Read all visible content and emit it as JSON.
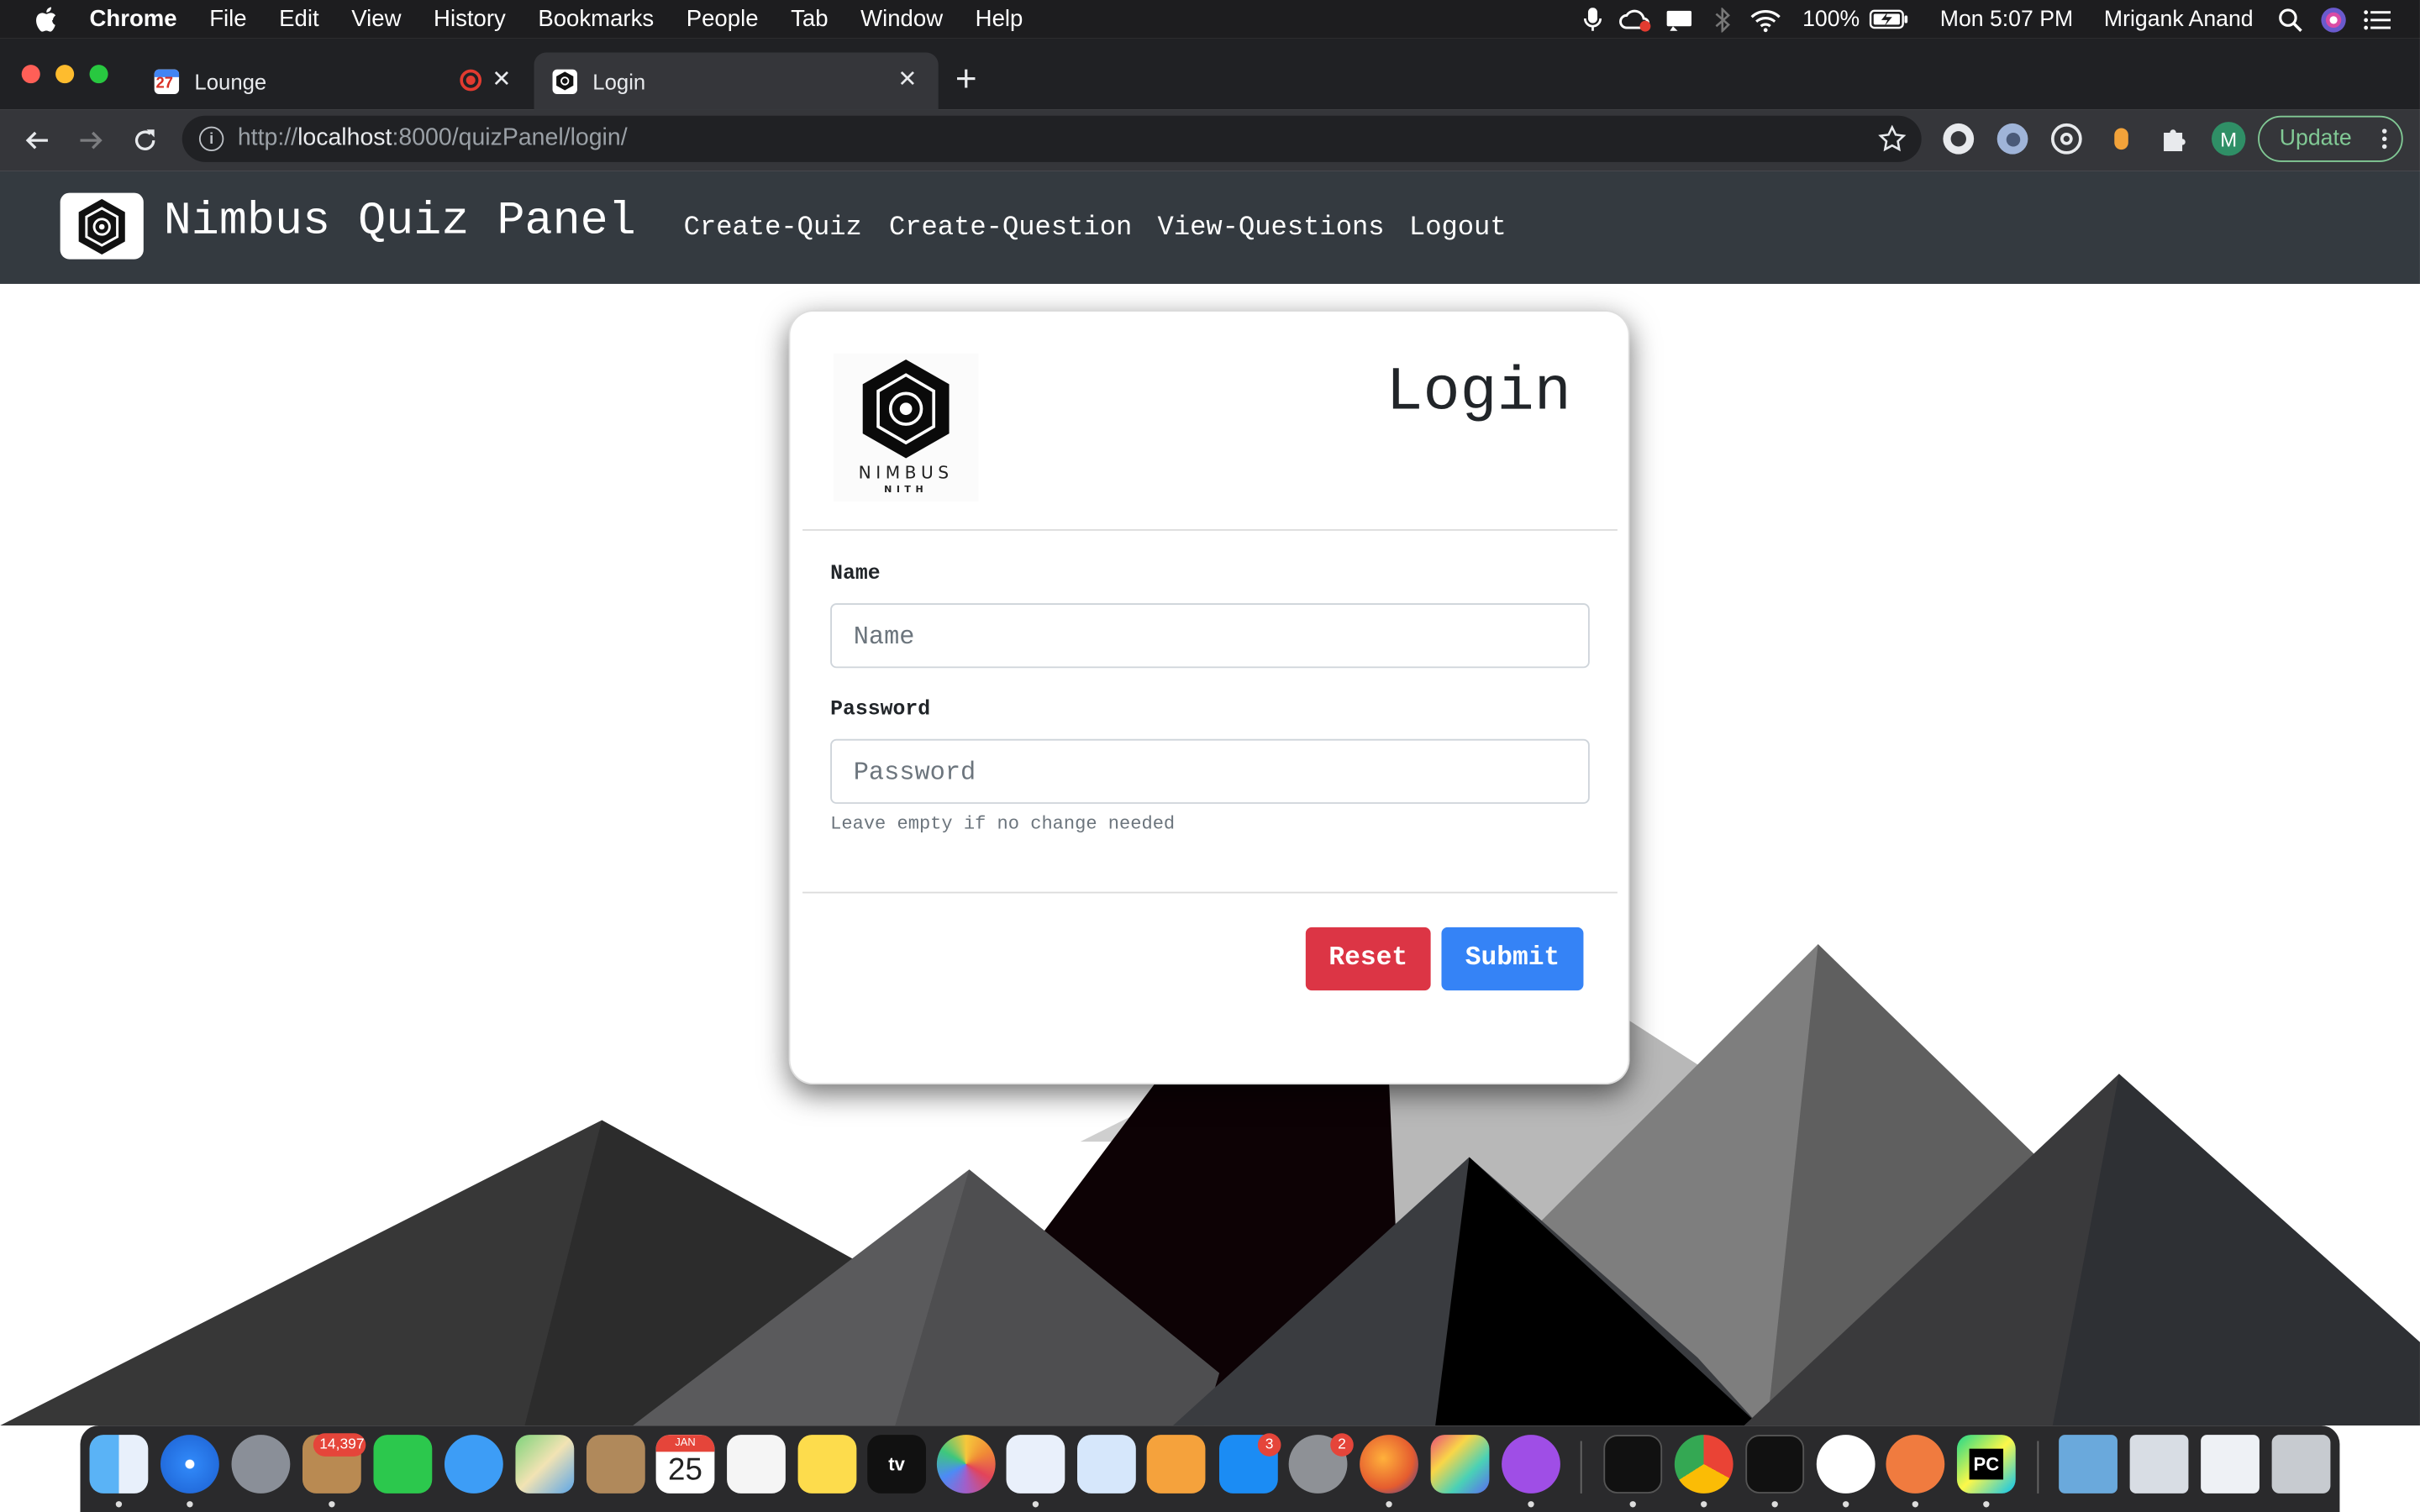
{
  "menubar": {
    "app": "Chrome",
    "items": [
      "File",
      "Edit",
      "View",
      "History",
      "Bookmarks",
      "People",
      "Tab",
      "Window",
      "Help"
    ],
    "battery": "100%",
    "clock": "Mon 5:07 PM",
    "user": "Mrigank Anand"
  },
  "tabs": [
    {
      "title": "Lounge",
      "favicon_text": "27"
    },
    {
      "title": "Login"
    }
  ],
  "addressbar": {
    "scheme": "http://",
    "host": "localhost",
    "rest": ":8000/quizPanel/login/"
  },
  "toolbar": {
    "profile_initial": "M",
    "update_label": "Update"
  },
  "site": {
    "brand": "Nimbus Quiz Panel",
    "nav": [
      "Create-Quiz",
      "Create-Question",
      "View-Questions",
      "Logout"
    ]
  },
  "login": {
    "title": "Login",
    "logo_word": "NIMBUS",
    "logo_sub": "NITH",
    "name_label": "Name",
    "name_placeholder": "Name",
    "password_label": "Password",
    "password_placeholder": "Password",
    "password_help": "Leave empty if no change needed",
    "reset_label": "Reset",
    "submit_label": "Submit"
  },
  "dock": {
    "mail_badge": "14,397",
    "calendar_month": "JAN",
    "calendar_day": "25",
    "appstore_badge": "3",
    "prefs_badge": "2",
    "pycharm_text": "PC"
  },
  "colors": {
    "navbar": "#343a40",
    "reset": "#dc3545",
    "submit": "#3583f6",
    "update_border": "#81c995",
    "recording": "#e23b30"
  }
}
